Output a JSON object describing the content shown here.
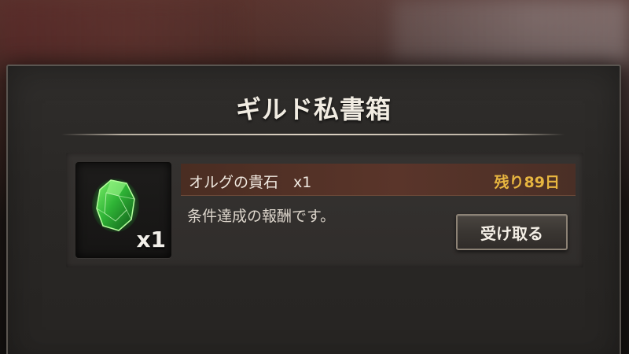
{
  "dialog": {
    "title": "ギルド私書箱"
  },
  "mail": {
    "item": {
      "icon": "green-gem-icon",
      "name": "オルグの貴石　x1",
      "count_label": "x1"
    },
    "remaining": "残り89日",
    "description": "条件達成の報酬です。",
    "receive_button_label": "受け取る"
  },
  "colors": {
    "remaining_text": "#e8b640",
    "name_bar": "#5a352a",
    "gem": "#3fd24a"
  }
}
